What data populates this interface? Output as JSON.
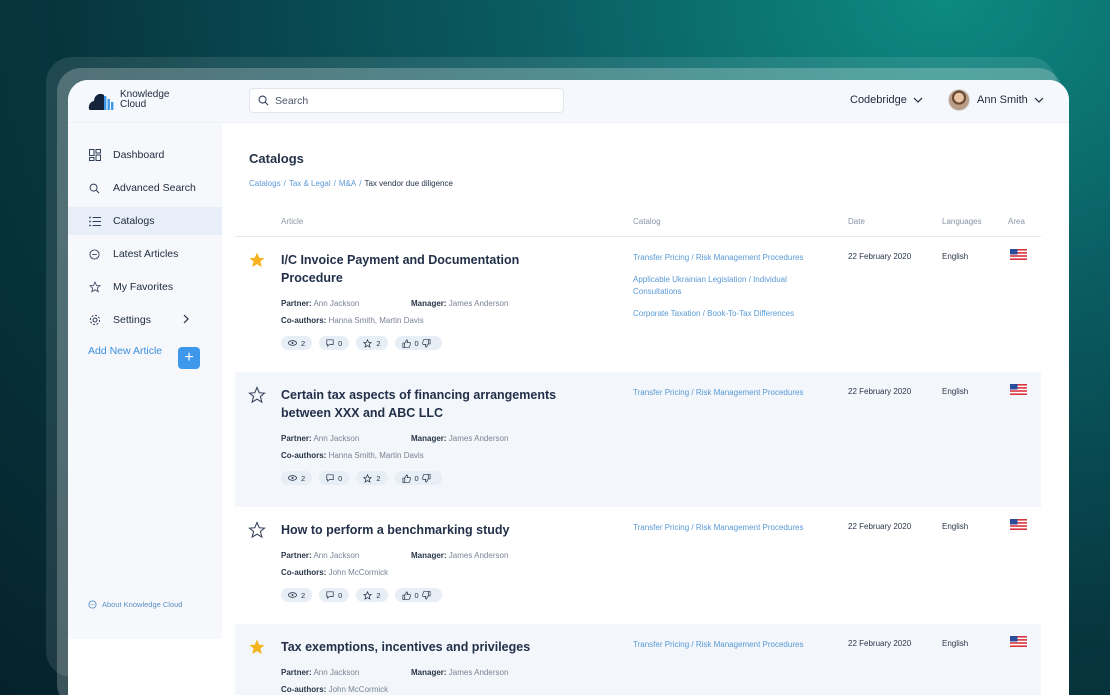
{
  "app": {
    "logo_line1": "Knowledge",
    "logo_line2": "Cloud",
    "search_placeholder": "Search",
    "org_name": "Codebridge",
    "user_name": "Ann Smith"
  },
  "sidebar": {
    "items": [
      {
        "label": "Dashboard",
        "icon": "dashboard-icon"
      },
      {
        "label": "Advanced Search",
        "icon": "search-icon"
      },
      {
        "label": "Catalogs",
        "icon": "list-icon",
        "active": true
      },
      {
        "label": "Latest Articles",
        "icon": "clock-icon"
      },
      {
        "label": "My Favorites",
        "icon": "star-icon"
      },
      {
        "label": "Settings",
        "icon": "gear-icon"
      }
    ],
    "add_article_label": "Add New Article",
    "add_button_label": "+",
    "about_label": "About Knowledge Cloud"
  },
  "main": {
    "title": "Catalogs",
    "breadcrumb": {
      "parts": [
        "Catalogs",
        "Tax & Legal",
        "M&A"
      ],
      "separator": "/",
      "current": "Tax vendor due diligence"
    },
    "columns": {
      "article": "Article",
      "catalog": "Catalog",
      "date": "Date",
      "languages": "Languages",
      "area": "Area"
    },
    "labels": {
      "partner": "Partner:",
      "manager": "Manager:",
      "coauthors": "Co-authors:"
    },
    "articles": [
      {
        "starred": true,
        "title": "I/C Invoice Payment and Documentation Procedure",
        "partner": "Ann Jackson",
        "manager": "James Anderson",
        "coauthors": "Hanna Smith, Martin Davis",
        "views": "2",
        "comments": "0",
        "stars": "2",
        "likes": "0",
        "catalogs": [
          "Transfer Pricing / Risk Management Procedures",
          "Applicable Ukrainian Legislation / Individual Consultations",
          "Corporate Taxation / Book-To-Tax Differences"
        ],
        "date": "22 February 2020",
        "language": "English",
        "area": "us-flag-icon"
      },
      {
        "starred": false,
        "title": "Certain tax aspects of financing arrangements between XXX and ABC LLC",
        "partner": "Ann Jackson",
        "manager": "James Anderson",
        "coauthors": "Hanna Smith, Martin Davis",
        "views": "2",
        "comments": "0",
        "stars": "2",
        "likes": "0",
        "catalogs": [
          "Transfer Pricing / Risk Management Procedures"
        ],
        "date": "22 February 2020",
        "language": "English",
        "area": "us-flag-icon"
      },
      {
        "starred": false,
        "title": "How to perform a benchmarking study",
        "partner": "Ann Jackson",
        "manager": "James Anderson",
        "coauthors": "John McCormick",
        "views": "2",
        "comments": "0",
        "stars": "2",
        "likes": "0",
        "catalogs": [
          "Transfer Pricing / Risk Management Procedures"
        ],
        "date": "22 February 2020",
        "language": "English",
        "area": "us-flag-icon"
      },
      {
        "starred": true,
        "title": "Tax exemptions, incentives and privileges",
        "partner": "Ann Jackson",
        "manager": "James Anderson",
        "coauthors": "John McCormick",
        "views": "",
        "comments": "",
        "stars": "",
        "likes": "",
        "catalogs": [
          "Transfer Pricing / Risk Management Procedures"
        ],
        "date": "22 February 2020",
        "language": "English",
        "area": "us-flag-icon"
      }
    ]
  },
  "colors": {
    "accent": "#3d98ec",
    "star_filled": "#f5b320",
    "link": "#5a9ad6"
  }
}
